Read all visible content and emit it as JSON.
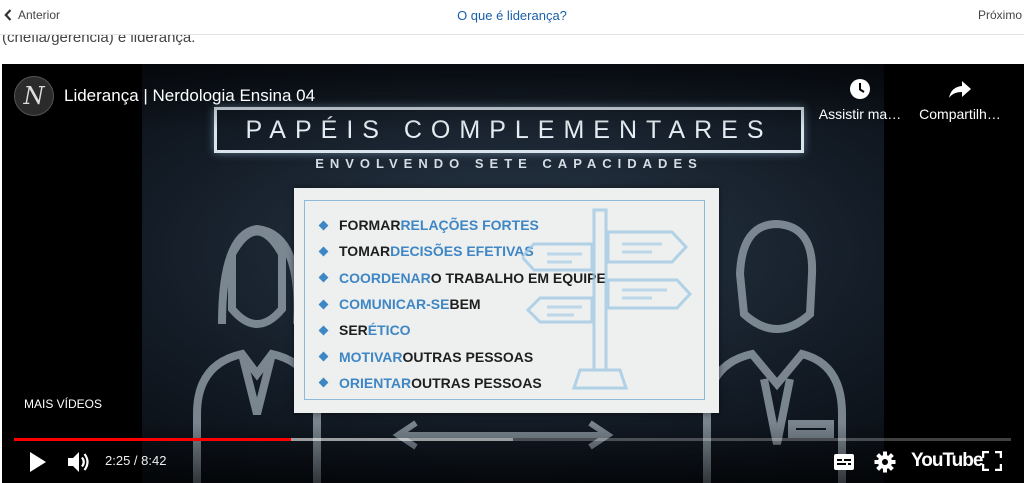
{
  "nav": {
    "prev_label": "Anterior",
    "title": "O que é liderança?",
    "next_label": "Próximo"
  },
  "page": {
    "clipped_text": "(chefia/gerência) e liderança."
  },
  "player": {
    "channel_initial": "N",
    "video_title": "Liderança | Nerdologia Ensina 04",
    "watch_later_label": "Assistir ma…",
    "share_label": "Compartilh…",
    "more_videos_label": "MAIS VÍDEOS",
    "time_display": "2:25 / 8:42",
    "youtube_label": "YouTube",
    "progress_played_fraction": 0.278,
    "progress_buffered_fraction": 0.5,
    "accent_color": "#ff0000"
  },
  "slide": {
    "title": "PAPÉIS COMPLEMENTARES",
    "subtitle": "ENVOLVENDO SETE CAPACIDADES",
    "capacities": [
      {
        "before": "FORMAR ",
        "highlight": "RELAÇÕES FORTES",
        "after": ""
      },
      {
        "before": "TOMAR ",
        "highlight": "DECISÕES EFETIVAS",
        "after": ""
      },
      {
        "before": "",
        "highlight": "COORDENAR",
        "after": " O TRABALHO EM EQUIPE"
      },
      {
        "before": "",
        "highlight": "COMUNICAR-SE",
        "after": " BEM"
      },
      {
        "before": "SER ",
        "highlight": "ÉTICO",
        "after": ""
      },
      {
        "before": "",
        "highlight": "MOTIVAR",
        "after": " OUTRAS PESSOAS"
      },
      {
        "before": "",
        "highlight": "ORIENTAR",
        "after": " OUTRAS PESSOAS"
      }
    ]
  },
  "icons": {
    "prev": "chevron-left-icon",
    "watch_later": "clock-icon",
    "share": "share-arrow-icon",
    "play": "play-icon",
    "volume": "volume-icon",
    "subtitles": "subtitles-icon",
    "settings": "gear-icon",
    "fullscreen": "fullscreen-icon"
  }
}
